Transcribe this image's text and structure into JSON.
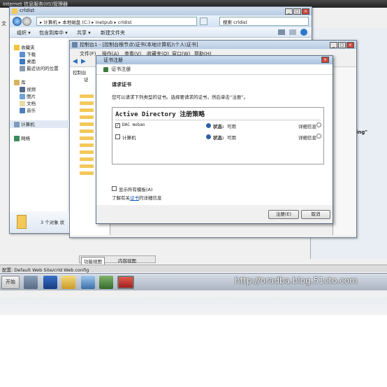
{
  "iis": {
    "title": "Internet 信息服务(IIS)管理器",
    "right_panel_text_1": "ping\"",
    "bottom_path_label": "配置:",
    "bottom_path": "Default Web Site/crld Web.config",
    "feature_view_tab": "功能视图",
    "content_view_tab": "内容视图",
    "left_fragment_1": "文"
  },
  "explorer": {
    "title": "crldist",
    "path": "▸ 计算机 ▸ 本地磁盘 (C:) ▸ inetpub ▸ crldist",
    "search_placeholder": "搜索 crldist",
    "toolbar": {
      "organize": "组织 ▾",
      "include_in_library": "包含到库中 ▾",
      "share": "共享 ▾",
      "new_folder": "新建文件夹"
    },
    "nav": {
      "favorites": "收藏夹",
      "downloads": "下载",
      "desktop": "桌面",
      "recent": "最近访问的位置",
      "libraries": "库",
      "videos": "视频",
      "pictures": "图片",
      "documents": "文档",
      "music": "音乐",
      "computer": "计算机",
      "network": "网络"
    },
    "status": "3 个对象 状"
  },
  "mmc": {
    "title": "控制台1 - [控制台根节点\\证书(本地计算机)\\个人\\证书]",
    "menu": [
      "文件(F)",
      "操作(A)",
      "查看(V)",
      "收藏夹(O)",
      "窗口(W)",
      "帮助(H)"
    ],
    "tree_root": "控制台",
    "tree_cert": "证"
  },
  "dialog": {
    "title": "证书注册",
    "header": "证书注册",
    "section_title": "请求证书",
    "instruction": "您可以请求下列类型的证书。选择要请求的证书，然后单击“注册”。",
    "policy_title": "Active Directory 注册策略",
    "templates": [
      {
        "name": "DAC moban",
        "checked": true,
        "status_label": "状态:",
        "status_value": "可用",
        "details": "详细信息"
      },
      {
        "name": "计算机",
        "checked": false,
        "status_label": "状态:",
        "status_value": "可用",
        "details": "详细信息"
      }
    ],
    "show_all_label": "显示所有模板(A)",
    "learn_more_prefix": "了解有关",
    "learn_more_link": "证书",
    "learn_more_suffix": "的详细信息",
    "enroll_button": "注册(E)",
    "cancel_button": "取消"
  },
  "taskbar": {
    "start_label": "开始"
  },
  "watermark": "http://oradba.blog.51cto.com"
}
